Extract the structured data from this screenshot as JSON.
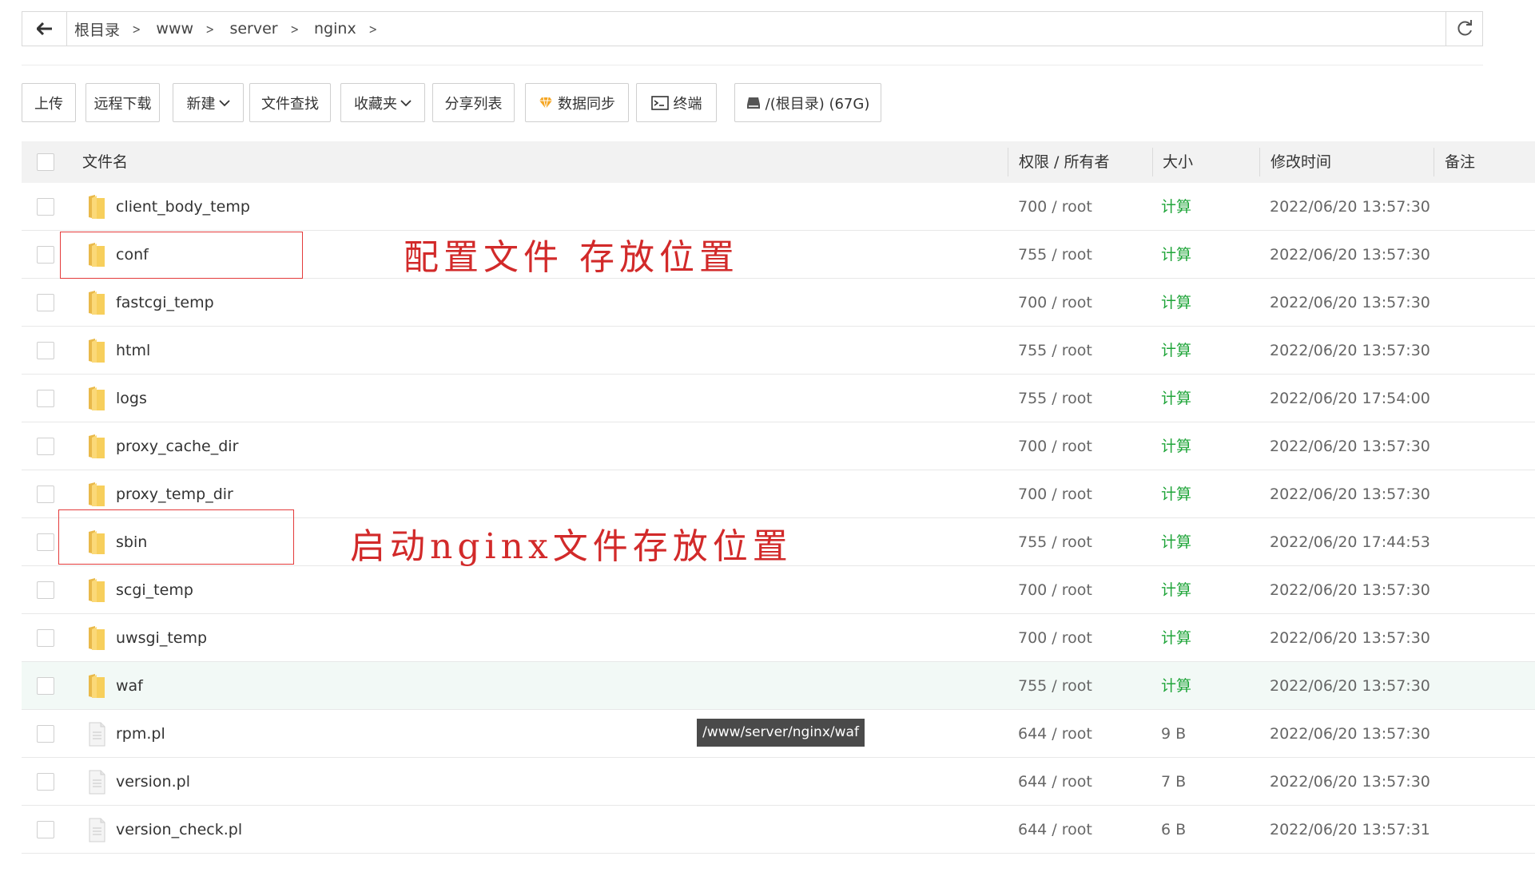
{
  "pathbar": {
    "crumbs": [
      "根目录",
      "www",
      "server",
      "nginx"
    ]
  },
  "toolbar": {
    "upload": "上传",
    "remote_download": "远程下载",
    "new": "新建",
    "file_search": "文件查找",
    "favorites": "收藏夹",
    "share_list": "分享列表",
    "data_sync": "数据同步",
    "terminal": "终端",
    "disk": "/(根目录) (67G)"
  },
  "table": {
    "headers": {
      "name": "文件名",
      "perm": "权限 / 所有者",
      "size": "大小",
      "mtime": "修改时间",
      "note": "备注"
    },
    "rows": [
      {
        "name": "client_body_temp",
        "type": "folder",
        "perm": "700 / root",
        "size": "计算",
        "mtime": "2022/06/20 13:57:30"
      },
      {
        "name": "conf",
        "type": "folder",
        "perm": "755 / root",
        "size": "计算",
        "mtime": "2022/06/20 13:57:30"
      },
      {
        "name": "fastcgi_temp",
        "type": "folder",
        "perm": "700 / root",
        "size": "计算",
        "mtime": "2022/06/20 13:57:30"
      },
      {
        "name": "html",
        "type": "folder",
        "perm": "755 / root",
        "size": "计算",
        "mtime": "2022/06/20 13:57:30"
      },
      {
        "name": "logs",
        "type": "folder",
        "perm": "755 / root",
        "size": "计算",
        "mtime": "2022/06/20 17:54:00"
      },
      {
        "name": "proxy_cache_dir",
        "type": "folder",
        "perm": "700 / root",
        "size": "计算",
        "mtime": "2022/06/20 13:57:30"
      },
      {
        "name": "proxy_temp_dir",
        "type": "folder",
        "perm": "700 / root",
        "size": "计算",
        "mtime": "2022/06/20 13:57:30"
      },
      {
        "name": "sbin",
        "type": "folder",
        "perm": "755 / root",
        "size": "计算",
        "mtime": "2022/06/20 17:44:53"
      },
      {
        "name": "scgi_temp",
        "type": "folder",
        "perm": "700 / root",
        "size": "计算",
        "mtime": "2022/06/20 13:57:30"
      },
      {
        "name": "uwsgi_temp",
        "type": "folder",
        "perm": "700 / root",
        "size": "计算",
        "mtime": "2022/06/20 13:57:30"
      },
      {
        "name": "waf",
        "type": "folder",
        "perm": "755 / root",
        "size": "计算",
        "mtime": "2022/06/20 13:57:30"
      },
      {
        "name": "rpm.pl",
        "type": "file",
        "perm": "644 / root",
        "size": "9 B",
        "mtime": "2022/06/20 13:57:30"
      },
      {
        "name": "version.pl",
        "type": "file",
        "perm": "644 / root",
        "size": "7 B",
        "mtime": "2022/06/20 13:57:30"
      },
      {
        "name": "version_check.pl",
        "type": "file",
        "perm": "644 / root",
        "size": "6 B",
        "mtime": "2022/06/20 13:57:31"
      }
    ]
  },
  "tooltip": "/www/server/nginx/waf",
  "annotations": {
    "conf_note": "配置文件 存放位置",
    "sbin_note": "启动nginx文件存放位置"
  },
  "colors": {
    "calc_green": "#20a53a",
    "annotation_red": "#d22a2a",
    "folder_yellow": "#f7cf5c"
  }
}
